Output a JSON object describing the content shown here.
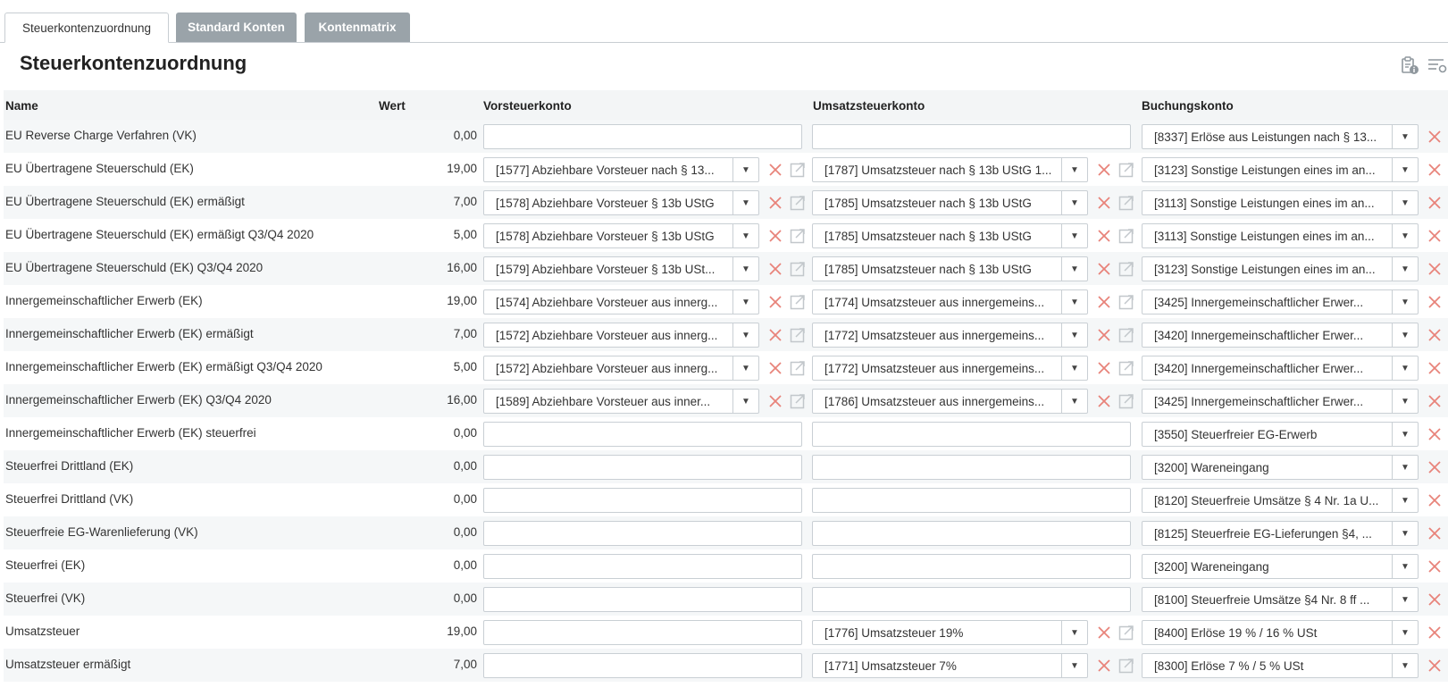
{
  "tabs": [
    {
      "label": "Steuerkontenzuordnung"
    },
    {
      "label": "Standard Konten"
    },
    {
      "label": "Kontenmatrix"
    }
  ],
  "page": {
    "title": "Steuerkontenzuordnung"
  },
  "toolbar": {
    "icons": [
      "clipboard-info-icon",
      "list-settings-icon"
    ]
  },
  "table": {
    "headers": {
      "name": "Name",
      "wert": "Wert",
      "vorsteuer": "Vorsteuerkonto",
      "umsatzsteuer": "Umsatzsteuerkonto",
      "buchung": "Buchungskonto"
    },
    "rows": [
      {
        "name": "EU Reverse Charge Verfahren (VK)",
        "wert": "0,00",
        "vorsteuer": "",
        "umsatzsteuer": "",
        "buchung": "[8337] Erlöse aus Leistungen nach § 13..."
      },
      {
        "name": "EU Übertragene Steuerschuld (EK)",
        "wert": "19,00",
        "vorsteuer": "[1577] Abziehbare Vorsteuer nach § 13...",
        "umsatzsteuer": "[1787] Umsatzsteuer nach § 13b UStG 1...",
        "buchung": "[3123] Sonstige Leistungen eines im an..."
      },
      {
        "name": "EU Übertragene Steuerschuld (EK) ermäßigt",
        "wert": "7,00",
        "vorsteuer": "[1578] Abziehbare Vorsteuer § 13b UStG",
        "umsatzsteuer": "[1785] Umsatzsteuer nach § 13b UStG",
        "buchung": "[3113] Sonstige Leistungen eines im an..."
      },
      {
        "name": "EU Übertragene Steuerschuld (EK) ermäßigt Q3/Q4 2020",
        "wert": "5,00",
        "vorsteuer": "[1578] Abziehbare Vorsteuer § 13b UStG",
        "umsatzsteuer": "[1785] Umsatzsteuer nach § 13b UStG",
        "buchung": "[3113] Sonstige Leistungen eines im an..."
      },
      {
        "name": "EU Übertragene Steuerschuld (EK) Q3/Q4 2020",
        "wert": "16,00",
        "vorsteuer": "[1579] Abziehbare Vorsteuer § 13b USt...",
        "umsatzsteuer": "[1785] Umsatzsteuer nach § 13b UStG",
        "buchung": "[3123] Sonstige Leistungen eines im an..."
      },
      {
        "name": "Innergemeinschaftlicher Erwerb (EK)",
        "wert": "19,00",
        "vorsteuer": "[1574] Abziehbare Vorsteuer aus innerg...",
        "umsatzsteuer": "[1774] Umsatzsteuer aus innergemeins...",
        "buchung": "[3425] Innergemeinschaftlicher Erwer..."
      },
      {
        "name": "Innergemeinschaftlicher Erwerb (EK) ermäßigt",
        "wert": "7,00",
        "vorsteuer": "[1572] Abziehbare Vorsteuer aus innerg...",
        "umsatzsteuer": "[1772] Umsatzsteuer aus innergemeins...",
        "buchung": "[3420] Innergemeinschaftlicher Erwer..."
      },
      {
        "name": "Innergemeinschaftlicher Erwerb (EK) ermäßigt Q3/Q4 2020",
        "wert": "5,00",
        "vorsteuer": "[1572] Abziehbare Vorsteuer aus innerg...",
        "umsatzsteuer": "[1772] Umsatzsteuer aus innergemeins...",
        "buchung": "[3420] Innergemeinschaftlicher Erwer..."
      },
      {
        "name": "Innergemeinschaftlicher Erwerb (EK) Q3/Q4 2020",
        "wert": "16,00",
        "vorsteuer": "[1589] Abziehbare Vorsteuer aus inner...",
        "umsatzsteuer": "[1786] Umsatzsteuer aus innergemeins...",
        "buchung": "[3425] Innergemeinschaftlicher Erwer..."
      },
      {
        "name": "Innergemeinschaftlicher Erwerb (EK) steuerfrei",
        "wert": "0,00",
        "vorsteuer": "",
        "umsatzsteuer": "",
        "buchung": "[3550] Steuerfreier EG-Erwerb"
      },
      {
        "name": "Steuerfrei Drittland (EK)",
        "wert": "0,00",
        "vorsteuer": "",
        "umsatzsteuer": "",
        "buchung": "[3200] Wareneingang"
      },
      {
        "name": "Steuerfrei Drittland (VK)",
        "wert": "0,00",
        "vorsteuer": "",
        "umsatzsteuer": "",
        "buchung": "[8120] Steuerfreie Umsätze § 4 Nr. 1a U..."
      },
      {
        "name": "Steuerfreie EG-Warenlieferung (VK)",
        "wert": "0,00",
        "vorsteuer": "",
        "umsatzsteuer": "",
        "buchung": "[8125] Steuerfreie EG-Lieferungen §4, ..."
      },
      {
        "name": "Steuerfrei (EK)",
        "wert": "0,00",
        "vorsteuer": "",
        "umsatzsteuer": "",
        "buchung": "[3200] Wareneingang"
      },
      {
        "name": "Steuerfrei (VK)",
        "wert": "0,00",
        "vorsteuer": "",
        "umsatzsteuer": "",
        "buchung": "[8100] Steuerfreie Umsätze §4 Nr. 8 ff ..."
      },
      {
        "name": "Umsatzsteuer",
        "wert": "19,00",
        "vorsteuer": "",
        "umsatzsteuer": "[1776] Umsatzsteuer 19%",
        "buchung": "[8400] Erlöse 19 % / 16 % USt"
      },
      {
        "name": "Umsatzsteuer ermäßigt",
        "wert": "7,00",
        "vorsteuer": "",
        "umsatzsteuer": "[1771] Umsatzsteuer 7%",
        "buchung": "[8300] Erlöse 7 % / 5 % USt"
      }
    ]
  },
  "colors": {
    "accent_delete": "#e8837a",
    "icon_gray": "#c2c7cb",
    "inactive_tab": "#9aa3a9"
  }
}
